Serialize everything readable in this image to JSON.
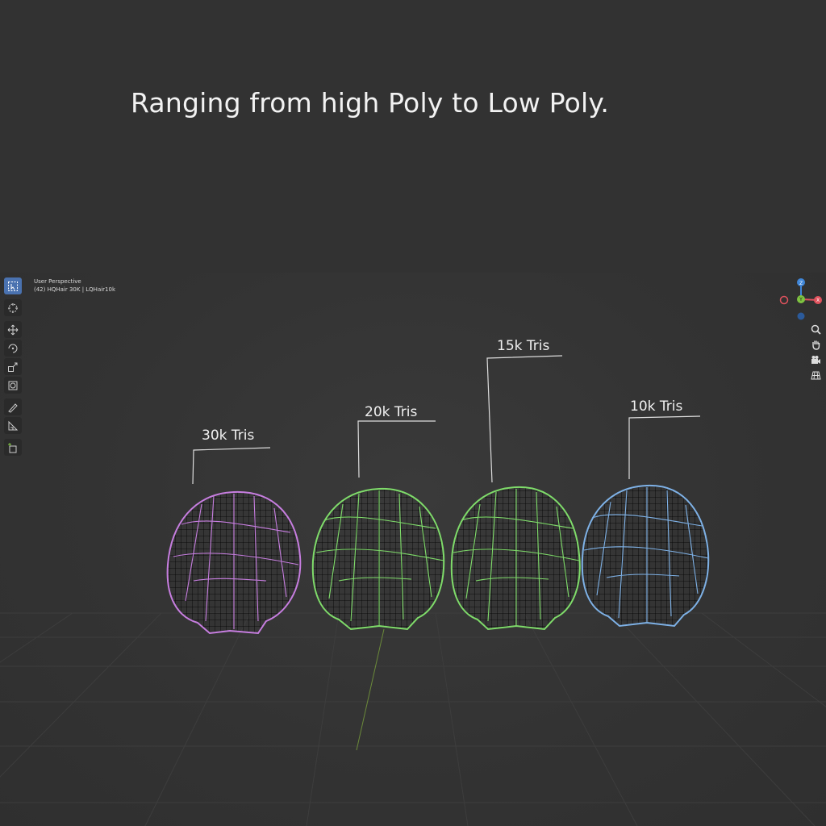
{
  "headline": "Ranging from high Poly to Low Poly.",
  "viewport": {
    "view_name": "User Perspective",
    "object_info": "(42) HQHair 30K | LQHair10k"
  },
  "toolbar": {
    "tools": [
      "select-box-icon",
      "cursor-icon",
      "move-icon",
      "rotate-icon",
      "scale-icon",
      "transform-icon",
      "annotate-icon",
      "measure-icon",
      "add-cube-icon"
    ]
  },
  "gizmo": {
    "z_label": "Z",
    "y_label": "Y",
    "x_label": "X"
  },
  "nav_icons": [
    "zoom-icon",
    "pan-hand-icon",
    "camera-icon",
    "ortho-grid-icon"
  ],
  "meshes": [
    {
      "label": "30k Tris",
      "color": "#c77ee0"
    },
    {
      "label": "20k Tris",
      "color": "#7fdc6a"
    },
    {
      "label": "15k Tris",
      "color": "#7fdc6a"
    },
    {
      "label": "10k Tris",
      "color": "#7eb1e6"
    }
  ],
  "colors": {
    "background": "#323232",
    "active_tool": "#4a72b0",
    "x_axis": "#e0525d",
    "y_axis": "#7fc341",
    "z_axis": "#3f86d8"
  }
}
